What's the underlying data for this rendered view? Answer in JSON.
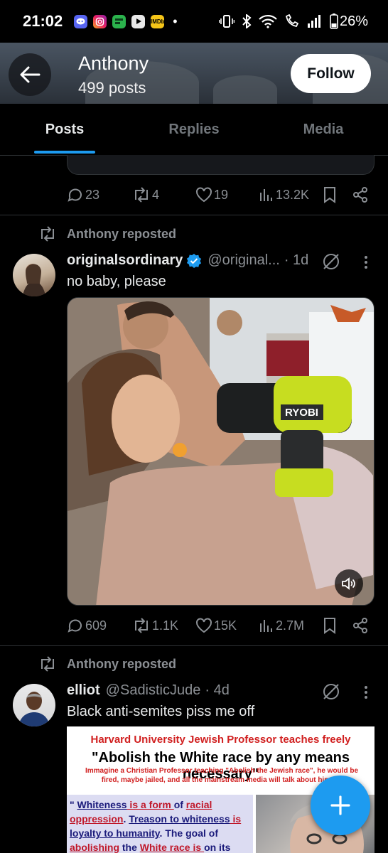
{
  "status_bar": {
    "time": "21:02",
    "battery": "26%",
    "notification_icons": [
      "discord-icon",
      "instagram-icon",
      "app-icon",
      "youtube-icon",
      "imdb-icon"
    ],
    "imdb_text": "IMDb"
  },
  "header": {
    "name": "Anthony",
    "post_count": "499 posts",
    "follow_label": "Follow"
  },
  "tabs": [
    {
      "label": "Posts",
      "active": true
    },
    {
      "label": "Replies",
      "active": false
    },
    {
      "label": "Media",
      "active": false
    }
  ],
  "post0": {
    "actions": {
      "replies": "23",
      "reposts": "4",
      "likes": "19",
      "views": "13.2K"
    }
  },
  "post1": {
    "repost_label": "Anthony reposted",
    "display_name": "originalsordinary",
    "verified": true,
    "handle": "@original...",
    "time": "· 1d",
    "text": "no baby, please",
    "media_watermark": "RYOBI",
    "actions": {
      "replies": "609",
      "reposts": "1.1K",
      "likes": "15K",
      "views": "2.7M"
    }
  },
  "post2": {
    "repost_label": "Anthony reposted",
    "display_name": "elliot",
    "handle": "@SadisticJude",
    "time": "· 4d",
    "text": "Black anti-semites piss me off",
    "image": {
      "line1": "Harvard University Jewish Professor teaches freely",
      "line2": "\"Abolish the White race by any means necessary\"",
      "line3": "Immagine a Christian Professor teaching \"Abolish the Jewish race\", he would be fired, maybe jailed, and all the mainstream media will talk about him for",
      "quote_parts": [
        {
          "text": "\" ",
          "style": "plain"
        },
        {
          "text": "Whiteness",
          "style": "b"
        },
        {
          "text": " is a form ",
          "style": "r"
        },
        {
          "text": "of ",
          "style": "plain"
        },
        {
          "text": "racial oppression",
          "style": "r"
        },
        {
          "text": ". ",
          "style": "plain"
        },
        {
          "text": "Treason to whiteness",
          "style": "b"
        },
        {
          "text": " is ",
          "style": "r"
        },
        {
          "text": "loyalty to humanity",
          "style": "b"
        },
        {
          "text": ". The goal of ",
          "style": "plain"
        },
        {
          "text": "abolishing",
          "style": "r"
        },
        {
          "text": " the ",
          "style": "plain"
        },
        {
          "text": "White race",
          "style": "r"
        },
        {
          "text": " is ",
          "style": "r"
        },
        {
          "text": "on its",
          "style": "plain"
        }
      ]
    }
  },
  "colors": {
    "accent": "#1d9bf0",
    "muted": "#8b8f94",
    "background": "#000000"
  }
}
